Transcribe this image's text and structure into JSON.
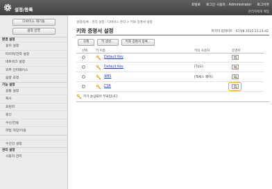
{
  "header": {
    "app_title": "설정/등록",
    "top_links": [
      "포털로",
      "로그인 사용자 : Administrator",
      "로그아웃"
    ],
    "admin_link": "관리자에게 메일"
  },
  "sidebar": {
    "buttons": [
      "디바이스 재기동",
      "설정 반영"
    ],
    "items": [
      {
        "type": "head",
        "label": "환경 설정"
      },
      {
        "type": "item",
        "label": "용지 설정"
      },
      {
        "type": "item",
        "label": "타이머/전력 설정"
      },
      {
        "type": "item",
        "label": "네트워크 설정"
      },
      {
        "type": "item",
        "label": "외부 인터페이스"
      },
      {
        "type": "item",
        "label": "음량 조정"
      },
      {
        "type": "head",
        "label": "기능 설정"
      },
      {
        "type": "item",
        "label": "공통 설정"
      },
      {
        "type": "item",
        "label": "복사"
      },
      {
        "type": "item",
        "label": "프린터"
      },
      {
        "type": "item",
        "label": "송신"
      },
      {
        "type": "item",
        "label": "수신/전송"
      },
      {
        "type": "item",
        "label": "파일 저장/이용"
      },
      {
        "type": "head",
        "label": ""
      },
      {
        "type": "item",
        "label": "수신인 설정"
      },
      {
        "type": "head",
        "label": "관리 설정"
      },
      {
        "type": "item",
        "label": "사용자 관리"
      }
    ]
  },
  "main": {
    "breadcrumb": "설정/등록 : 관리 설정 : 디바이스 관리 > 키와 증명서 설정",
    "title": "키와 증명서 설정",
    "last_updated": "마지막 업데이트 : 07/08 2015 21:21:42",
    "toolbar": {
      "delete": "삭제",
      "generate_key": "키 생성...",
      "register_key": "키와 증명서 등록..."
    },
    "columns": {
      "select": "선택",
      "key_name": "키 이름",
      "key_user": "키의 사용처",
      "certificate": "증명서"
    },
    "rows": [
      {
        "name": "Default Key",
        "user": ""
      },
      {
        "name": "Default Key",
        "user": "[TLS]"
      },
      {
        "name": "AMS",
        "user": "[액세스 제어]"
      },
      {
        "name": "CSR",
        "user": ""
      }
    ],
    "legend": "키가 손상되어 무효입니다."
  },
  "colors": {
    "link": "#1f45c5",
    "highlight": "#f0a81e",
    "header_bg": "#4a4a4a",
    "sidebar_bg": "#ececec"
  }
}
